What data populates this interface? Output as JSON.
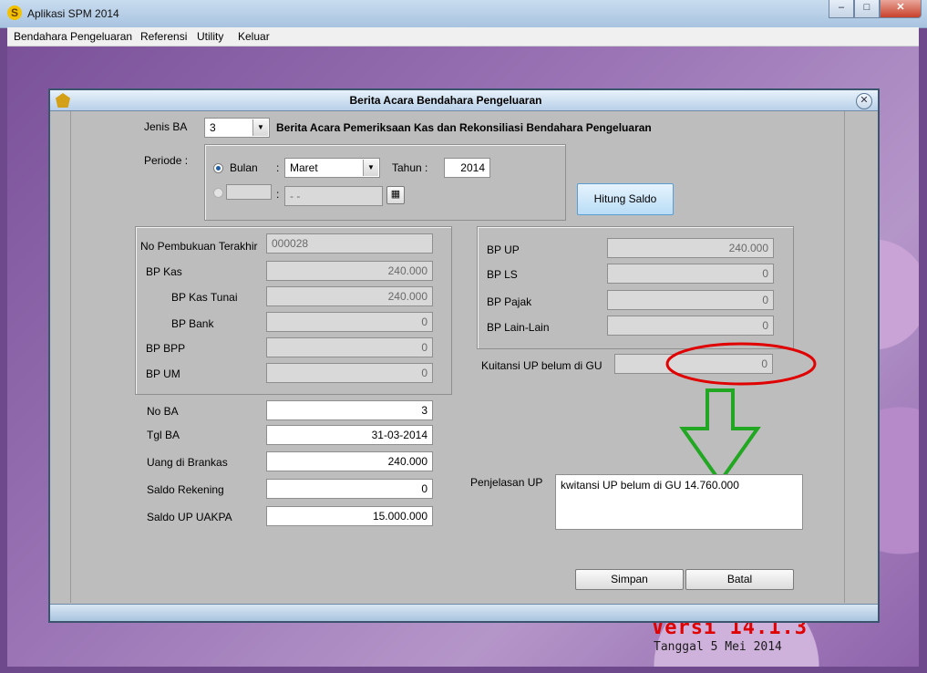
{
  "app": {
    "title": "Aplikasi SPM 2014",
    "icon_letter": "S",
    "menu": [
      "Bendahara Pengeluaran",
      "Referensi",
      "Utility",
      "Keluar"
    ],
    "version": "Versi 14.1.3",
    "build_date": "Tanggal 5 Mei 2014",
    "window_controls": {
      "minimize": "–",
      "maximize": "□",
      "close": "✕"
    }
  },
  "dialog": {
    "title": "Berita Acara Bendahara Pengeluaran",
    "close_glyph": "✕",
    "jenis_ba": {
      "label": "Jenis BA",
      "value": "3",
      "description": "Berita Acara Pemeriksaan Kas dan Rekonsiliasi Bendahara Pengeluaran"
    },
    "periode": {
      "label": "Periode :",
      "bulan_option": "Bulan",
      "colon": ":",
      "bulan_value": "Maret",
      "tahun_label": "Tahun :",
      "tahun_value": "2014",
      "date_value": "- -"
    },
    "hitung_saldo": "Hitung Saldo",
    "left_panel": {
      "no_pembukuan": {
        "label": "No Pembukuan Terakhir",
        "value": "000028"
      },
      "bp_kas": {
        "label": "BP Kas",
        "value": "240.000"
      },
      "bp_kas_tunai": {
        "label": "BP Kas Tunai",
        "value": "240.000"
      },
      "bp_bank": {
        "label": "BP Bank",
        "value": "0"
      },
      "bp_bpp": {
        "label": "BP BPP",
        "value": "0"
      },
      "bp_um": {
        "label": "BP UM",
        "value": "0"
      }
    },
    "right_panel": {
      "bp_up": {
        "label": "BP UP",
        "value": "240.000"
      },
      "bp_ls": {
        "label": "BP LS",
        "value": "0"
      },
      "bp_pajak": {
        "label": "BP Pajak",
        "value": "0"
      },
      "bp_lain": {
        "label": "BP Lain-Lain",
        "value": "0"
      }
    },
    "kuitansi": {
      "label": "Kuitansi UP belum di GU",
      "value": "0"
    },
    "form": {
      "no_ba": {
        "label": "No BA",
        "value": "3"
      },
      "tgl_ba": {
        "label": "Tgl  BA",
        "value": "31-03-2014"
      },
      "uang_brankas": {
        "label": "Uang di Brankas",
        "value": "240.000"
      },
      "saldo_rekening": {
        "label": "Saldo Rekening",
        "value": "0"
      },
      "saldo_up_uakpa": {
        "label": "Saldo UP UAKPA",
        "value": "15.000.000"
      }
    },
    "penjelasan": {
      "label": "Penjelasan UP",
      "value": "kwitansi UP belum di GU 14.760.000"
    },
    "buttons": {
      "simpan": "Simpan",
      "batal": "Batal"
    }
  },
  "annotation_colors": {
    "circle": "#e00000",
    "arrow": "#22a722"
  }
}
